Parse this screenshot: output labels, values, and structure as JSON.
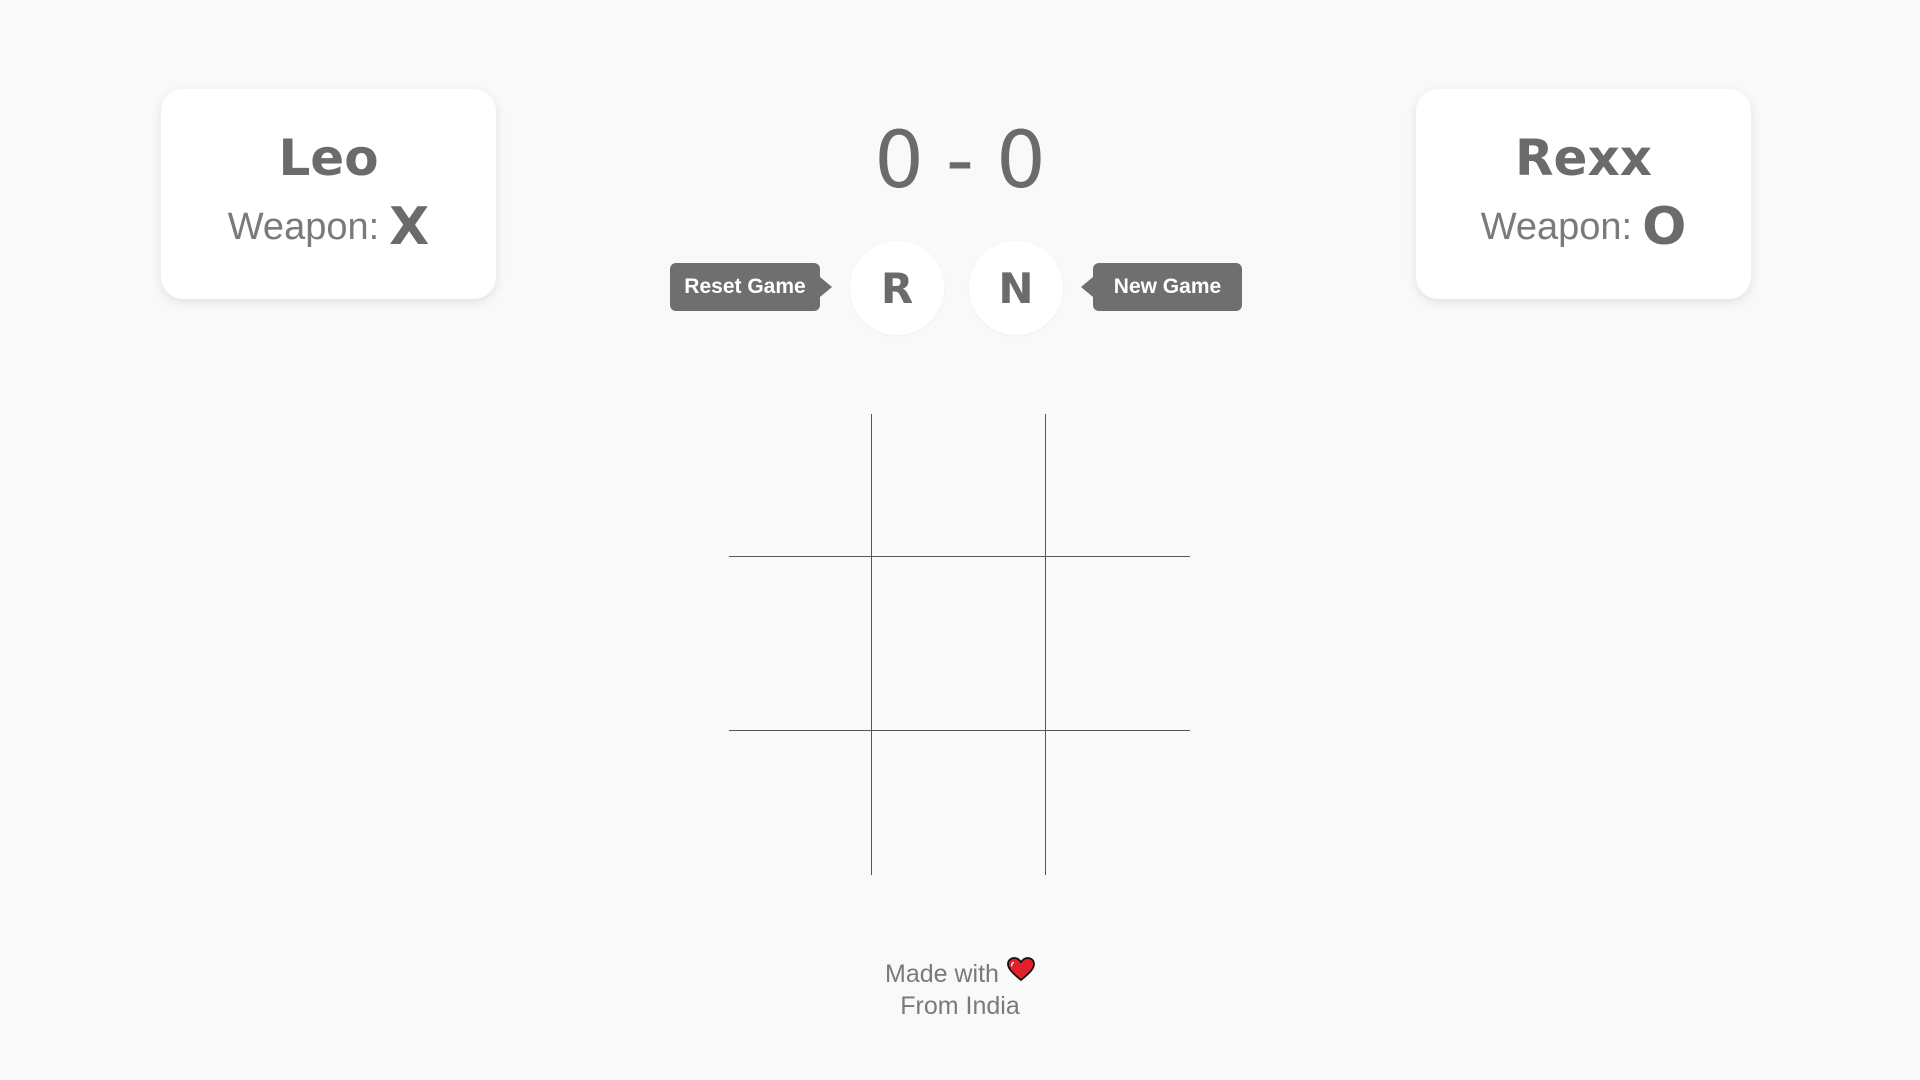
{
  "players": [
    {
      "name": "Leo",
      "weapon_label": "Weapon:",
      "weapon": "X"
    },
    {
      "name": "Rexx",
      "weapon_label": "Weapon:",
      "weapon": "O"
    }
  ],
  "score": {
    "left": "0",
    "separator": "-",
    "right": "0"
  },
  "controls": {
    "reset_button": "R",
    "reset_tooltip": "Reset Game",
    "new_button": "N",
    "new_tooltip": "New Game"
  },
  "board": {
    "cells": [
      "",
      "",
      "",
      "",
      "",
      "",
      "",
      "",
      ""
    ]
  },
  "footer": {
    "line1": "Made with",
    "heart_icon": "heart-icon",
    "line2": "From India"
  },
  "colors": {
    "background": "#f9f9f9",
    "text": "#6b6b6b",
    "tooltip": "#6f6f6f",
    "heart": "#e0202a"
  }
}
